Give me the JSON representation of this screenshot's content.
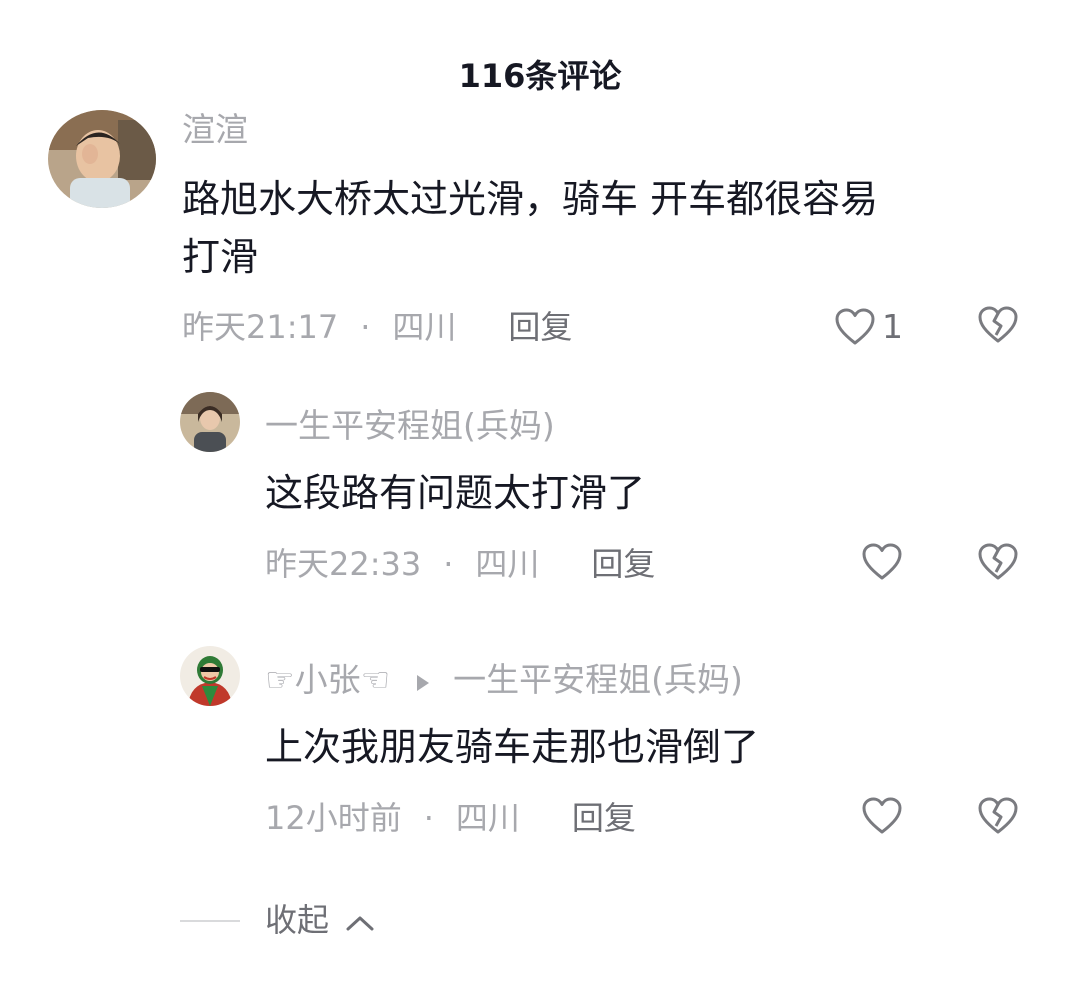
{
  "header": {
    "title": "116条评论"
  },
  "comments": [
    {
      "username": "渲渲",
      "text_line1": "路旭水大桥太过光滑，骑车 开车都很容易",
      "text_line2": "打滑",
      "time": "昨天21:17",
      "separator": "·",
      "location": "四川",
      "reply_label": "回复",
      "likes": "1"
    }
  ],
  "replies": [
    {
      "username": "一生平安程姐(兵妈)",
      "text": "这段路有问题太打滑了",
      "time": "昨天22:33",
      "separator": "·",
      "location": "四川",
      "reply_label": "回复"
    },
    {
      "username": "☞小张☜",
      "reply_to": "一生平安程姐(兵妈)",
      "text": "上次我朋友骑车走那也滑倒了",
      "time": "12小时前",
      "separator": "·",
      "location": "四川",
      "reply_label": "回复"
    }
  ],
  "footer": {
    "collapse_label": "收起"
  },
  "icons": {
    "like": "heart-outline-icon",
    "dislike": "broken-heart-icon",
    "reply_arrow": "triangle-right-icon",
    "collapse": "chevron-up-icon"
  },
  "colors": {
    "primary_text": "#161823",
    "secondary_text": "#a7a8ad",
    "action_text": "#6e6f75"
  }
}
